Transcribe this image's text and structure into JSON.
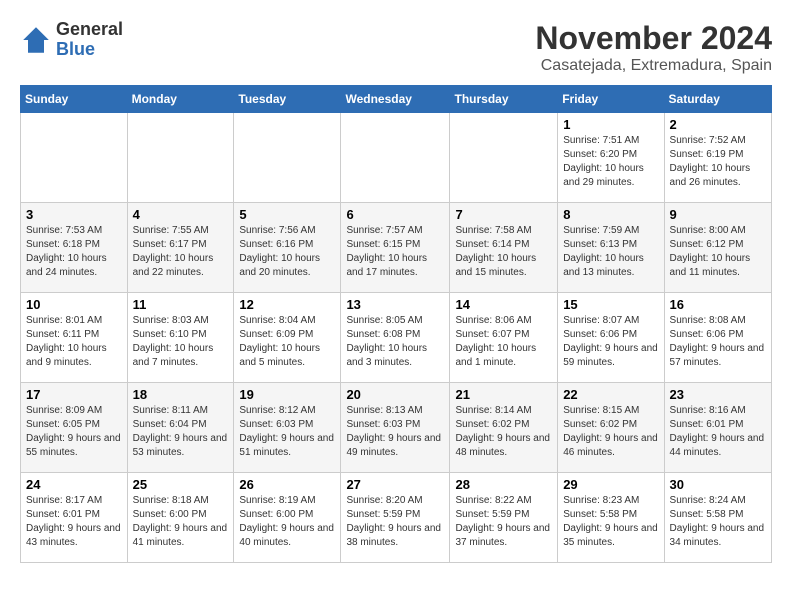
{
  "logo": {
    "general": "General",
    "blue": "Blue"
  },
  "header": {
    "month_year": "November 2024",
    "location": "Casatejada, Extremadura, Spain"
  },
  "weekdays": [
    "Sunday",
    "Monday",
    "Tuesday",
    "Wednesday",
    "Thursday",
    "Friday",
    "Saturday"
  ],
  "weeks": [
    [
      {
        "day": "",
        "info": ""
      },
      {
        "day": "",
        "info": ""
      },
      {
        "day": "",
        "info": ""
      },
      {
        "day": "",
        "info": ""
      },
      {
        "day": "",
        "info": ""
      },
      {
        "day": "1",
        "info": "Sunrise: 7:51 AM\nSunset: 6:20 PM\nDaylight: 10 hours and 29 minutes."
      },
      {
        "day": "2",
        "info": "Sunrise: 7:52 AM\nSunset: 6:19 PM\nDaylight: 10 hours and 26 minutes."
      }
    ],
    [
      {
        "day": "3",
        "info": "Sunrise: 7:53 AM\nSunset: 6:18 PM\nDaylight: 10 hours and 24 minutes."
      },
      {
        "day": "4",
        "info": "Sunrise: 7:55 AM\nSunset: 6:17 PM\nDaylight: 10 hours and 22 minutes."
      },
      {
        "day": "5",
        "info": "Sunrise: 7:56 AM\nSunset: 6:16 PM\nDaylight: 10 hours and 20 minutes."
      },
      {
        "day": "6",
        "info": "Sunrise: 7:57 AM\nSunset: 6:15 PM\nDaylight: 10 hours and 17 minutes."
      },
      {
        "day": "7",
        "info": "Sunrise: 7:58 AM\nSunset: 6:14 PM\nDaylight: 10 hours and 15 minutes."
      },
      {
        "day": "8",
        "info": "Sunrise: 7:59 AM\nSunset: 6:13 PM\nDaylight: 10 hours and 13 minutes."
      },
      {
        "day": "9",
        "info": "Sunrise: 8:00 AM\nSunset: 6:12 PM\nDaylight: 10 hours and 11 minutes."
      }
    ],
    [
      {
        "day": "10",
        "info": "Sunrise: 8:01 AM\nSunset: 6:11 PM\nDaylight: 10 hours and 9 minutes."
      },
      {
        "day": "11",
        "info": "Sunrise: 8:03 AM\nSunset: 6:10 PM\nDaylight: 10 hours and 7 minutes."
      },
      {
        "day": "12",
        "info": "Sunrise: 8:04 AM\nSunset: 6:09 PM\nDaylight: 10 hours and 5 minutes."
      },
      {
        "day": "13",
        "info": "Sunrise: 8:05 AM\nSunset: 6:08 PM\nDaylight: 10 hours and 3 minutes."
      },
      {
        "day": "14",
        "info": "Sunrise: 8:06 AM\nSunset: 6:07 PM\nDaylight: 10 hours and 1 minute."
      },
      {
        "day": "15",
        "info": "Sunrise: 8:07 AM\nSunset: 6:06 PM\nDaylight: 9 hours and 59 minutes."
      },
      {
        "day": "16",
        "info": "Sunrise: 8:08 AM\nSunset: 6:06 PM\nDaylight: 9 hours and 57 minutes."
      }
    ],
    [
      {
        "day": "17",
        "info": "Sunrise: 8:09 AM\nSunset: 6:05 PM\nDaylight: 9 hours and 55 minutes."
      },
      {
        "day": "18",
        "info": "Sunrise: 8:11 AM\nSunset: 6:04 PM\nDaylight: 9 hours and 53 minutes."
      },
      {
        "day": "19",
        "info": "Sunrise: 8:12 AM\nSunset: 6:03 PM\nDaylight: 9 hours and 51 minutes."
      },
      {
        "day": "20",
        "info": "Sunrise: 8:13 AM\nSunset: 6:03 PM\nDaylight: 9 hours and 49 minutes."
      },
      {
        "day": "21",
        "info": "Sunrise: 8:14 AM\nSunset: 6:02 PM\nDaylight: 9 hours and 48 minutes."
      },
      {
        "day": "22",
        "info": "Sunrise: 8:15 AM\nSunset: 6:02 PM\nDaylight: 9 hours and 46 minutes."
      },
      {
        "day": "23",
        "info": "Sunrise: 8:16 AM\nSunset: 6:01 PM\nDaylight: 9 hours and 44 minutes."
      }
    ],
    [
      {
        "day": "24",
        "info": "Sunrise: 8:17 AM\nSunset: 6:01 PM\nDaylight: 9 hours and 43 minutes."
      },
      {
        "day": "25",
        "info": "Sunrise: 8:18 AM\nSunset: 6:00 PM\nDaylight: 9 hours and 41 minutes."
      },
      {
        "day": "26",
        "info": "Sunrise: 8:19 AM\nSunset: 6:00 PM\nDaylight: 9 hours and 40 minutes."
      },
      {
        "day": "27",
        "info": "Sunrise: 8:20 AM\nSunset: 5:59 PM\nDaylight: 9 hours and 38 minutes."
      },
      {
        "day": "28",
        "info": "Sunrise: 8:22 AM\nSunset: 5:59 PM\nDaylight: 9 hours and 37 minutes."
      },
      {
        "day": "29",
        "info": "Sunrise: 8:23 AM\nSunset: 5:58 PM\nDaylight: 9 hours and 35 minutes."
      },
      {
        "day": "30",
        "info": "Sunrise: 8:24 AM\nSunset: 5:58 PM\nDaylight: 9 hours and 34 minutes."
      }
    ]
  ]
}
